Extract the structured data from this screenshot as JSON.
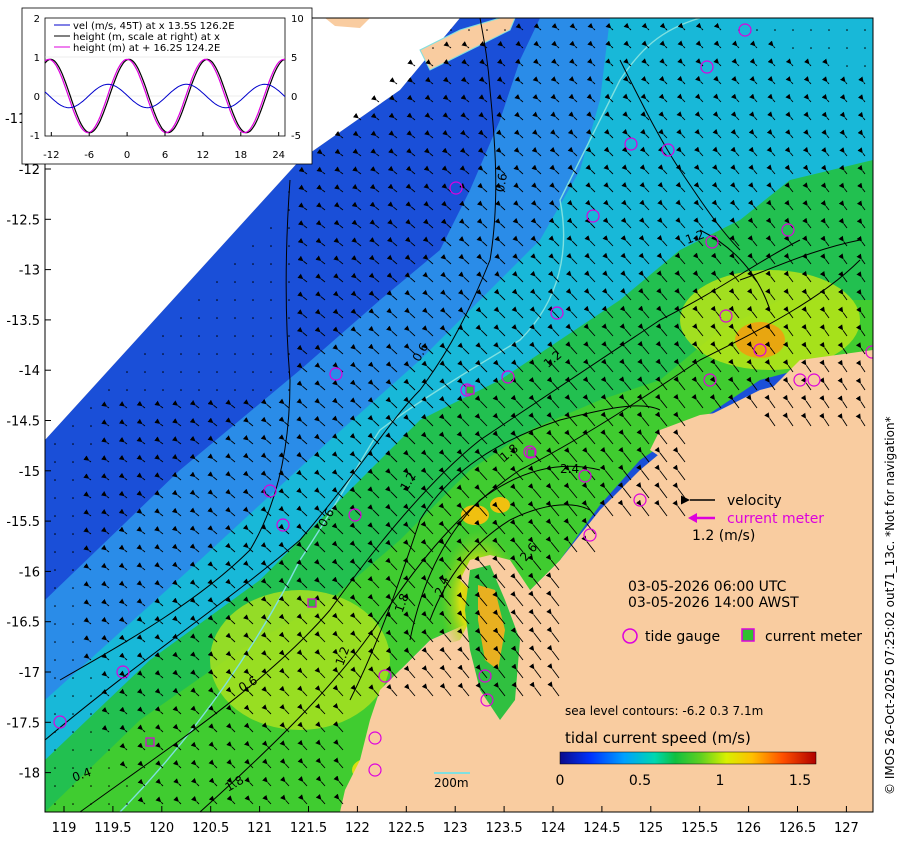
{
  "x_ticks": [
    "119",
    "119.5",
    "120",
    "120.5",
    "121",
    "121.5",
    "122",
    "122.5",
    "123",
    "123.5",
    "124",
    "124.5",
    "125",
    "125.5",
    "126",
    "126.5",
    "127"
  ],
  "y_ticks": [
    "-12",
    "-12.5",
    "-13",
    "-13.5",
    "-14",
    "-14.5",
    "-15",
    "-15.5",
    "-16",
    "-16.5",
    "-17",
    "-17.5",
    "-18"
  ],
  "y_tick_partial": "-11",
  "inset": {
    "legend": [
      "vel (m/s, 45T) at x 13.5S 126.2E",
      "height (m, scale at right) at x",
      "height (m) at + 16.2S 124.2E"
    ],
    "left_ticks": [
      "2",
      "1",
      "0",
      "-1"
    ],
    "right_ticks": [
      "10",
      "5",
      "0",
      "-5"
    ],
    "bottom_ticks": [
      "-12",
      "-6",
      "0",
      "6",
      "12",
      "18",
      "24"
    ],
    "colors": {
      "vel": "#0000cc",
      "height_x": "#000000",
      "height_plus": "#dd00dd"
    }
  },
  "legend": {
    "velocity": "velocity",
    "current_meter_arrow": "current meter",
    "scale": "1.2 (m/s)",
    "time_utc": "03-05-2026 06:00 UTC",
    "time_awst": "03-05-2026 14:00 AWST",
    "tide_gauge": "tide gauge",
    "current_meter": "current meter",
    "sea_level": "sea level contours: -6.2 0.3 7.1m",
    "colorbar_title": "tidal current speed (m/s)",
    "colorbar_ticks": [
      "0",
      "0.5",
      "1",
      "1.5"
    ],
    "colorbar_range": [
      0,
      1.6
    ],
    "depth": "200m"
  },
  "contour_labels": [
    "0.6",
    "0.6",
    "0.6",
    "0.6",
    "1.2",
    "1.2",
    "1.2",
    "1.2",
    "1.8",
    "1.8",
    "1.8",
    "2.4",
    "2.4",
    "2.6",
    "0.4"
  ],
  "credit": "© IMOS 26-Oct-2025 07:25:02 out71_13c. *Not for navigation*",
  "colors": {
    "land": "#f9cca0",
    "deep": "#1a4fd8",
    "tide_gauge": "#dd00dd",
    "current_meter": "#dd00dd",
    "contour_200m": "#7fe0e0"
  }
}
